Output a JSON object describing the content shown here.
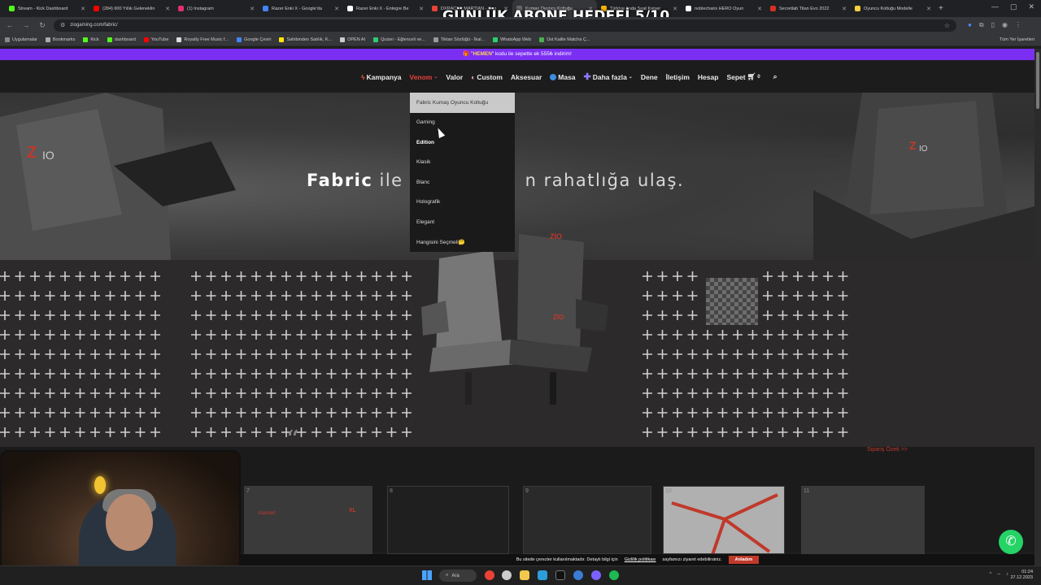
{
  "overlay": {
    "title": "GÜNLÜK ABONE HEDEFİ 5/10"
  },
  "browser": {
    "tabs": [
      {
        "title": "Stream - Kick Dashboard",
        "color": "#53fc18"
      },
      {
        "title": "(284) 600 Yıllık Geleneklin",
        "color": "#ff0000"
      },
      {
        "title": "(1) Instagram",
        "color": "#e1306c"
      },
      {
        "title": "Razer Enki X - Google'da",
        "color": "#4285f4"
      },
      {
        "title": "Razer Enki X - Entegre Be",
        "color": "#ffffff"
      },
      {
        "title": "DXRACER MARTIAN - Goo",
        "color": "#ea4335"
      },
      {
        "title": "Kumaş Oyuncu Koltuğu",
        "color": "#666666",
        "active": true
      },
      {
        "title": "Türkiye Anda Seat Kaiser",
        "color": "#f4b400"
      },
      {
        "title": "noblechairs HERO Oyun",
        "color": "#ffffff"
      },
      {
        "title": "Secretlab Titan Evo 2022",
        "color": "#d93025"
      },
      {
        "title": "Oyuncu Koltuğu Modelle",
        "color": "#f4d03f"
      }
    ],
    "new_tab": "+",
    "url": "ziogaming.com/fabric/",
    "bookmarks": [
      {
        "label": "Uygulamalar",
        "color": "#888888"
      },
      {
        "label": "Bookmarks",
        "color": "#aaaaaa"
      },
      {
        "label": "Kick",
        "color": "#53fc18"
      },
      {
        "label": "dashboard",
        "color": "#53fc18"
      },
      {
        "label": "YouTube",
        "color": "#ff0000"
      },
      {
        "label": "Royalty Free Music f...",
        "color": "#dddddd"
      },
      {
        "label": "Google Çeviri",
        "color": "#4285f4"
      },
      {
        "label": "Sahibinden Satılık, K...",
        "color": "#ffe800"
      },
      {
        "label": "OPEN AI",
        "color": "#cccccc"
      },
      {
        "label": "Quizei - Eğlenceli ve...",
        "color": "#2ecc71"
      },
      {
        "label": "Tiktan Sözlüğü - İkal...",
        "color": "#999999"
      },
      {
        "label": "WhatsApp Web",
        "color": "#25d366"
      },
      {
        "label": "Üst Kalite Matcha Ç...",
        "color": "#4caf50"
      }
    ],
    "all_bookmarks": "Tüm Yer İşaretleri"
  },
  "promo": {
    "pre": "🎁 \"",
    "code": "HEMEN",
    "post": "\" kodu ile sepette ek 555₺ indirim!"
  },
  "nav": {
    "items": [
      "Kampanya",
      "Venom",
      "Valor",
      "Custom",
      "Aksesuar",
      "Masa",
      "Daha fazla",
      "Dene",
      "İletişim",
      "Hesap"
    ],
    "cart_label": "Sepet",
    "cart_count": "0"
  },
  "dropdown": {
    "items": [
      "Fabric Kumaş Oyuncu Koltuğu",
      "Gaming",
      "Edition",
      "Klasik",
      "Blanc",
      "Holografik",
      "Elegant",
      "Hangisini Seçmeli🤔"
    ]
  },
  "hero": {
    "word_bold": "Fabric",
    "rest_left": " ile",
    "rest_right": "n rahatlığa ulaş.",
    "logo": "ZIO"
  },
  "section": {
    "quote_mark": "“",
    "order_summary": "Sipariş Özeti >>"
  },
  "thumbs": [
    {
      "num": "7",
      "tag": "standart",
      "size": "XL"
    },
    {
      "num": "8"
    },
    {
      "num": "9"
    },
    {
      "num": "10"
    },
    {
      "num": "11"
    }
  ],
  "cookie": {
    "text": "Bu sitede çerezler kullanılmaktadır. Detaylı bilgi için",
    "link": "Gizlilik politikası",
    "text2": "sayfamızı ziyaret edebilirsiniz.",
    "button": "Anladım"
  },
  "taskbar": {
    "search": "Ara",
    "time": "01:24",
    "date": "27.12.2023"
  },
  "colors": {
    "accent": "#7b2ff2",
    "brand_red": "#e8413c",
    "whatsapp": "#25d366"
  }
}
